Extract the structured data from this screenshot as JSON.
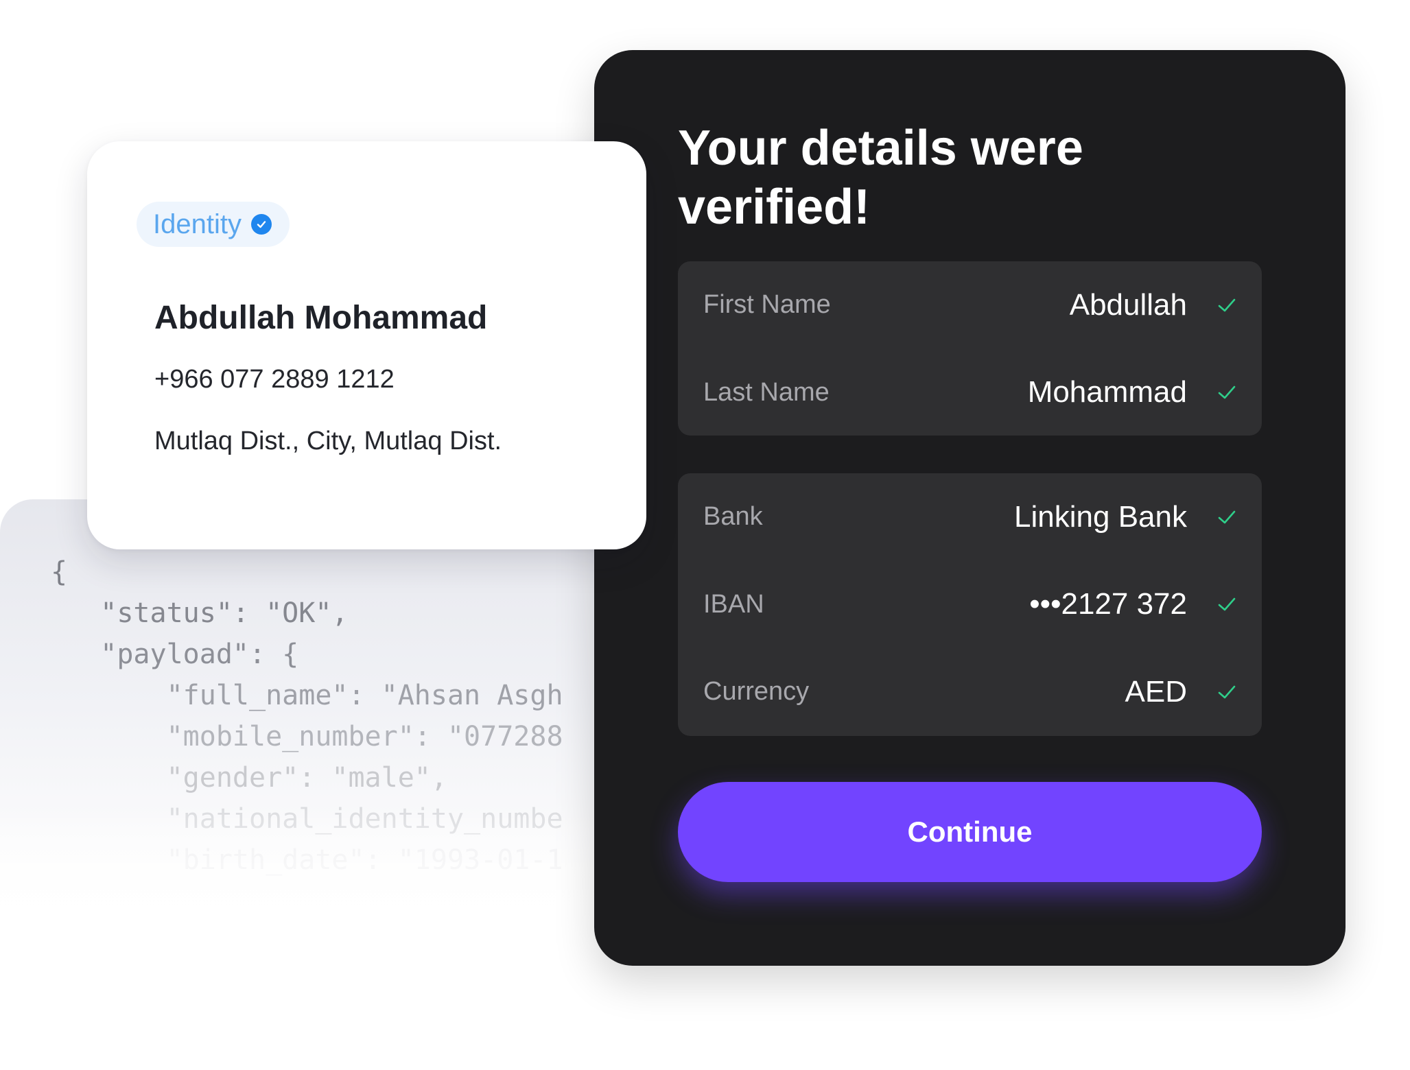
{
  "code_snippet": {
    "lines": [
      "{",
      "   \"status\": \"OK\",",
      "   \"payload\": {",
      "       \"full_name\": \"Ahsan Asgh",
      "       \"mobile_number\": \"077288",
      "       \"gender\": \"male\",",
      "       \"national_identity_numbe",
      "       \"birth_date\": \"1993-01-1"
    ]
  },
  "identity_card": {
    "badge_label": "Identity",
    "badge_icon": "verified-check-icon",
    "name": "Abdullah Mohammad",
    "phone": "+966 077 2889 1212",
    "address": "Mutlaq Dist., City, Mutlaq Dist."
  },
  "verification": {
    "title": "Your details were verified!",
    "groups": [
      {
        "rows": [
          {
            "label": "First Name",
            "value": "Abdullah"
          },
          {
            "label": "Last Name",
            "value": "Mohammad"
          }
        ]
      },
      {
        "rows": [
          {
            "label": "Bank",
            "value": "Linking Bank"
          },
          {
            "label": "IBAN",
            "value": "•••2127 372"
          },
          {
            "label": "Currency",
            "value": "AED"
          }
        ]
      }
    ],
    "continue_label": "Continue"
  },
  "colors": {
    "accent": "#7244ff",
    "check": "#2fcf8a",
    "panel_bg": "#1c1c1e",
    "badge_blue": "#1f86ee"
  }
}
